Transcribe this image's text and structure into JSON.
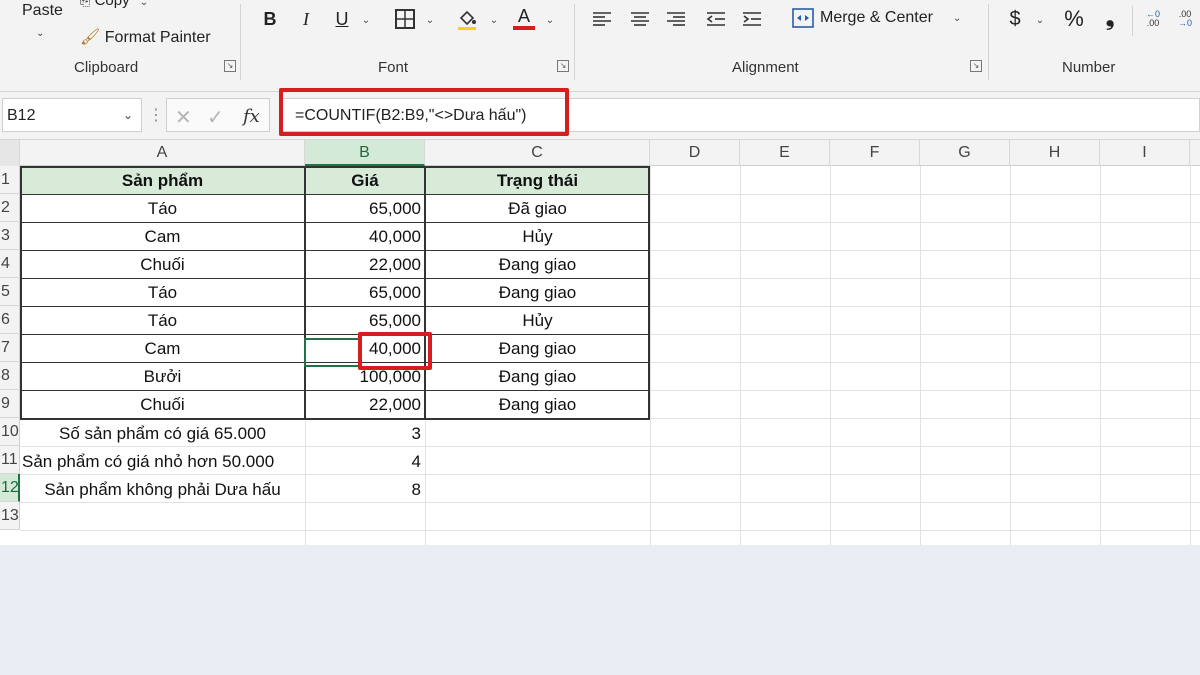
{
  "ribbon": {
    "clipboard": {
      "paste": "Paste",
      "copy": "Copy",
      "format_painter": "Format Painter",
      "label": "Clipboard"
    },
    "font": {
      "bold": "B",
      "italic": "I",
      "underline": "U",
      "font_color_letter": "A",
      "label": "Font",
      "accent_color": "#d71e1e"
    },
    "alignment": {
      "merge_center": "Merge & Center",
      "label": "Alignment"
    },
    "number": {
      "currency": "$",
      "percent": "%",
      "comma": "❟",
      "label": "Number"
    }
  },
  "formula_bar": {
    "name_box": "B12",
    "fx": "fx",
    "formula": "=COUNTIF(B2:B9,\"<>Dưa hấu\")"
  },
  "columns": [
    "A",
    "B",
    "C",
    "D",
    "E",
    "F",
    "G",
    "H",
    "I"
  ],
  "rows": [
    "1",
    "2",
    "3",
    "4",
    "5",
    "6",
    "7",
    "8",
    "9",
    "10",
    "11",
    "12",
    "13"
  ],
  "table": {
    "headers": [
      "Sản phẩm",
      "Giá",
      "Trạng thái"
    ],
    "rows": [
      [
        "Táo",
        "65,000",
        "Đã giao"
      ],
      [
        "Cam",
        "40,000",
        "Hủy"
      ],
      [
        "Chuối",
        "22,000",
        "Đang giao"
      ],
      [
        "Táo",
        "65,000",
        "Đang giao"
      ],
      [
        "Táo",
        "65,000",
        "Hủy"
      ],
      [
        "Cam",
        "40,000",
        "Đang giao"
      ],
      [
        "Bưởi",
        "100,000",
        "Đang giao"
      ],
      [
        "Chuối",
        "22,000",
        "Đang giao"
      ]
    ],
    "header_fill": "#d8ebd9"
  },
  "summary": [
    {
      "label": "Số sản phẩm có giá 65.000",
      "value": "3"
    },
    {
      "label": "Sản phẩm có giá  nhỏ hơn 50.000",
      "value": "4"
    },
    {
      "label": "Sản phẩm không phải Dưa hấu",
      "value": "8"
    }
  ],
  "colors": {
    "highlight": "#d71e1e",
    "selection": "#217346"
  }
}
